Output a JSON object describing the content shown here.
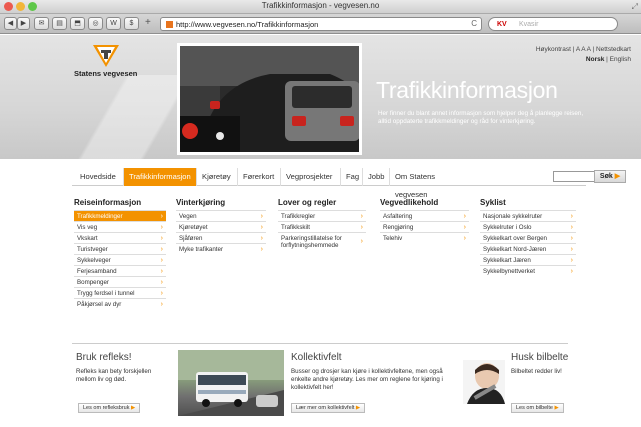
{
  "window": {
    "title": "Trafikkinformasjon - vegvesen.no"
  },
  "toolbar": {
    "url": "http://www.vegvesen.no/Trafikkinformasjon",
    "search_engine": "KV",
    "search_placeholder": "Kvasir",
    "reload_icon": "reload-icon",
    "buttons": [
      "◀",
      "▶",
      "✉",
      "▤",
      "⬒",
      "◎",
      "W",
      "$"
    ]
  },
  "header": {
    "brand": "Statens vegvesen",
    "util_links": "Høykontrast | A A A | Nettstedkart",
    "lang_active": "Norsk",
    "lang_other": "| English",
    "page_title": "Trafikkinformasjon",
    "description": "Her finner du blant annet informasjon som hjelper deg å planlegge reisen, alltid oppdaterte trafikkmeldinger og råd for vinterkjøring."
  },
  "nav": {
    "items": [
      "Hovedside",
      "Trafikkinformasjon",
      "Kjøretøy",
      "Førerkort",
      "Vegprosjekter",
      "Fag",
      "Jobb",
      "Om Statens vegvesen"
    ],
    "search_button": "Søk"
  },
  "columns": [
    {
      "heading": "Reiseinformasjon",
      "items": [
        "Trafikkmeldinger",
        "Vis veg",
        "Vkskart",
        "Turistveger",
        "Sykkelveger",
        "Ferjesamband",
        "Bompenger",
        "Trygg ferdsel i tunnel",
        "Påkjørsel av dyr"
      ]
    },
    {
      "heading": "Vinterkjøring",
      "items": [
        "Vegen",
        "Kjøretøyet",
        "Sjåføren",
        "Myke trafikanter"
      ]
    },
    {
      "heading": "Lover og regler",
      "items": [
        "Trafikkregler",
        "Trafikkskilt",
        "Parkeringstillatelse for forflytningshemmede"
      ]
    },
    {
      "heading": "Vegvedlikehold",
      "items": [
        "Asfaltering",
        "Rengjøring",
        "Telehiv"
      ]
    },
    {
      "heading": "Syklist",
      "items": [
        "Nasjonale sykkelruter",
        "Sykkelruter i Oslo",
        "Sykkelkart over Bergen",
        "Sykkelkart Nord-Jæren",
        "Sykkelkart Jæren",
        "Sykkelbynettverket"
      ]
    }
  ],
  "bottom": {
    "refleks": {
      "title": "Bruk refleks!",
      "text": "Refleks kan bety forskjellen mellom liv og død.",
      "button": "Les om refleksbruk"
    },
    "kollektiv": {
      "title": "Kollektivfelt",
      "text": "Busser og drosjer kan kjøre i kollektivfeltene, men også enkelte andre kjøretøy. Les mer om reglene for kjøring i kollektivfelt her!",
      "button": "Lær mer om kollektivfelt"
    },
    "bilbelte": {
      "title": "Husk bilbelte",
      "text": "Bilbeltet redder liv!",
      "button": "Les om bilbelte"
    }
  },
  "colors": {
    "accent": "#f39200",
    "title_text": "#ffffff"
  }
}
